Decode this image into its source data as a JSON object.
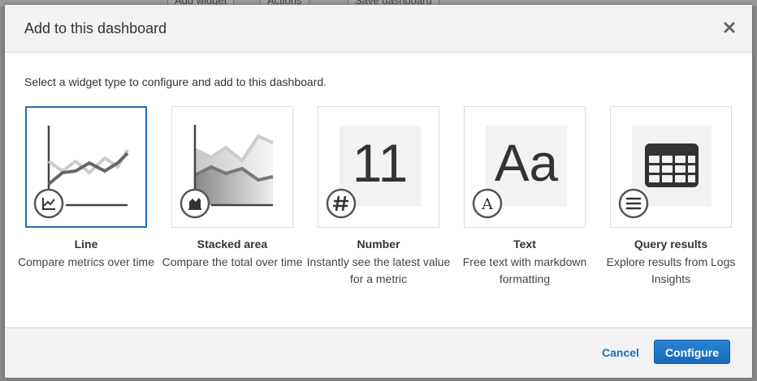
{
  "background": {
    "toolbar": {
      "add_widget": "Add widget",
      "actions": "Actions",
      "save_dashboard": "Save dashboard"
    }
  },
  "modal": {
    "title": "Add to this dashboard",
    "intro": "Select a widget type to configure and add to this dashboard.",
    "widgets": [
      {
        "name": "Line",
        "description": "Compare metrics over time",
        "icon": "line-chart-icon",
        "selected": true
      },
      {
        "name": "Stacked area",
        "description": "Compare the total over time",
        "icon": "stacked-area-icon",
        "selected": false
      },
      {
        "name": "Number",
        "description": "Instantly see the latest value for a metric",
        "icon": "number-icon",
        "preview_text": "11",
        "selected": false
      },
      {
        "name": "Text",
        "description": "Free text with markdown formatting",
        "icon": "text-icon",
        "preview_text": "Aa",
        "selected": false
      },
      {
        "name": "Query results",
        "description": "Explore results from Logs Insights",
        "icon": "table-icon",
        "selected": false
      }
    ],
    "footer": {
      "cancel_label": "Cancel",
      "configure_label": "Configure"
    }
  },
  "colors": {
    "accent": "#1f6fb5",
    "primary_button": "#1a73c8"
  }
}
